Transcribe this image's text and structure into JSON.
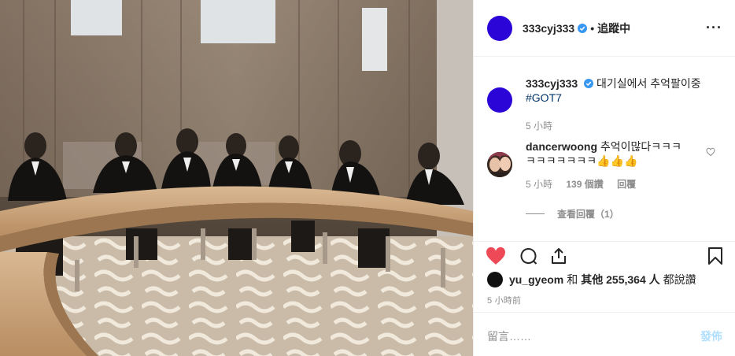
{
  "header": {
    "username": "333cyj333",
    "separator": "•",
    "follow_label": "追蹤中",
    "more_label": "···"
  },
  "caption": {
    "username": "333cyj333",
    "text": "대기실에서 추억팔이중",
    "hashtag": "#GOT7",
    "time": "5 小時"
  },
  "comment": {
    "username": "dancerwoong",
    "text_line1": "추억이많다ㅋㅋㅋ",
    "text_line2": "ㅋㅋㅋㅋㅋㅋㅋ👍👍👍",
    "time": "5 小時",
    "likes": "139 個讚",
    "reply_label": "回覆",
    "view_replies": "查看回覆（1）"
  },
  "likes": {
    "user": "yu_gyeom",
    "and": "和",
    "others_label": "其他 255,364 人",
    "suffix": "都說讚"
  },
  "time_ago": "5 小時前",
  "add_comment": {
    "placeholder": "留言……",
    "post_label": "發佈"
  },
  "colors": {
    "avatar_blue": "#2b05d8",
    "liked_heart": "#ed4956",
    "verified": "#3897f0",
    "post_button_disabled": "#b2dffc"
  },
  "icons": [
    "heart-icon",
    "comment-icon",
    "share-icon",
    "bookmark-icon",
    "verified-badge-icon",
    "more-options-icon",
    "small-heart-icon"
  ]
}
